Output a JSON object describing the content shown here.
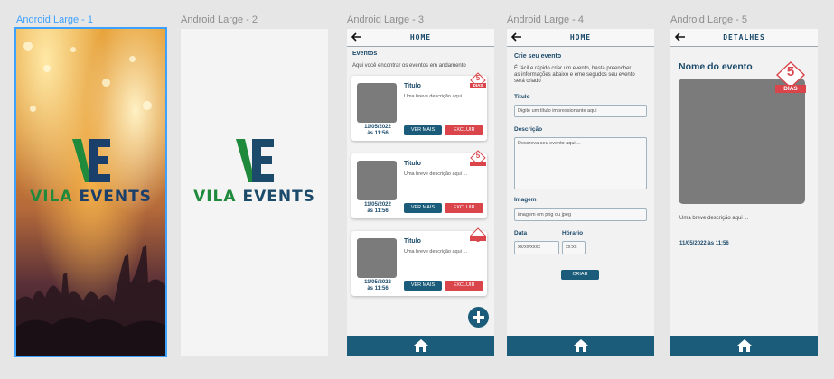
{
  "frames": [
    {
      "label": "Android Large - 1"
    },
    {
      "label": "Android Large - 2"
    },
    {
      "label": "Android Large - 3"
    },
    {
      "label": "Android Large - 4"
    },
    {
      "label": "Android Large - 5"
    }
  ],
  "brand": {
    "mark": "VE",
    "name_part1": "VILA",
    "name_part2": "EVENTS",
    "green": "#1f8a3b",
    "navy": "#1b4a6b"
  },
  "colors": {
    "accent": "#1a5c7a",
    "danger": "#d9454b",
    "selection": "#3da1ff"
  },
  "screen3": {
    "header_title": "HOME",
    "section_title": "Eventos",
    "section_sub": "Aqui você encontrar os eventos em andamento",
    "cards": [
      {
        "title": "Titulo",
        "desc": "Uma breve descrição aqui ...",
        "date": "11/05/2022",
        "time": "às 11:56",
        "badge_num": "5",
        "badge_tag": "DIAS",
        "btn_view": "VER MAIS",
        "btn_delete": "EXCLUIR"
      },
      {
        "title": "Titulo",
        "desc": "Uma breve descrição aqui ...",
        "date": "11/05/2022",
        "time": "às 11:56",
        "badge_num": "5",
        "badge_tag": "",
        "btn_view": "VER MAIS",
        "btn_delete": "EXCLUIR"
      },
      {
        "title": "Titulo",
        "desc": "Uma breve descrição aqui ...",
        "date": "11/05/2022",
        "time": "às 11:56",
        "badge_num": "",
        "badge_tag": "",
        "btn_view": "VER MAIS",
        "btn_delete": "EXCLUIR"
      }
    ],
    "fab_icon": "plus-icon"
  },
  "screen4": {
    "header_title": "HOME",
    "section_title": "Crie seu evento",
    "section_sub_1": "É fácil e rápido criar um evento, basta preencher",
    "section_sub_2": "as informações abaixo e eme segudos seu evento",
    "section_sub_3": "será criado",
    "title_label": "Titulo",
    "title_placeholder": "Digite um título impressionante aqui",
    "desc_label": "Descrição",
    "desc_placeholder": "Descreva seu evento aqui ...",
    "image_label": "Imagem",
    "image_placeholder": "imagem em png ou jpeg",
    "date_label": "Data",
    "date_placeholder": "xx/xx/xxxx",
    "time_label": "Hórario",
    "time_placeholder": "xx:xx",
    "submit_label": "CRIAR"
  },
  "screen5": {
    "header_title": "DETALHES",
    "event_name": "Nome do evento",
    "badge_num": "5",
    "badge_tag": "DIAS",
    "desc": "Uma breve descrição aqui ...",
    "datetime": "11/05/2022 às 11:56"
  }
}
